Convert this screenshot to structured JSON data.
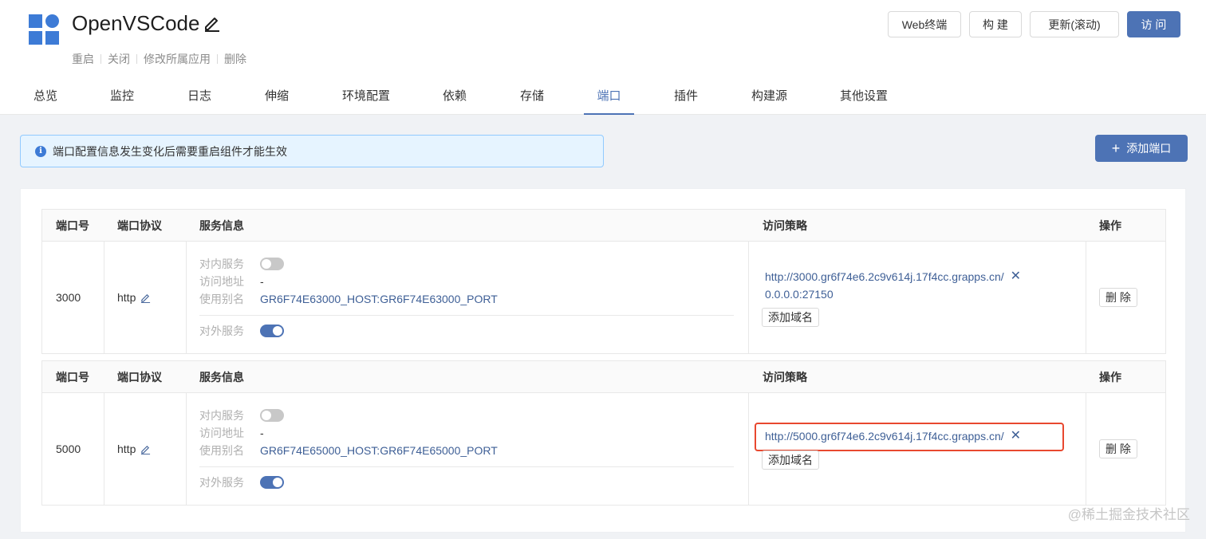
{
  "app": {
    "title": "OpenVSCode",
    "actions": [
      "重启",
      "关闭",
      "修改所属应用",
      "删除"
    ]
  },
  "top_buttons": [
    "Web终端",
    "构 建",
    "更新(滚动)",
    "访 问"
  ],
  "tabs": [
    "总览",
    "监控",
    "日志",
    "伸缩",
    "环境配置",
    "依赖",
    "存储",
    "端口",
    "插件",
    "构建源",
    "其他设置"
  ],
  "active_tab": "端口",
  "notice": {
    "icon": "info-icon",
    "text": "端口配置信息发生变化后需要重启组件才能生效"
  },
  "add_port_label": "添加端口",
  "table_headers": {
    "port": "端口号",
    "protocol": "端口协议",
    "service": "服务信息",
    "access": "访问策略",
    "ops": "操作"
  },
  "service_labels": {
    "internal": "对内服务",
    "address": "访问地址",
    "alias": "使用别名",
    "external": "对外服务"
  },
  "ports": [
    {
      "port": "3000",
      "protocol": "http",
      "internal_enabled": false,
      "address": "-",
      "alias": "GR6F74E63000_HOST:GR6F74E63000_PORT",
      "external_enabled": true,
      "url": "http://3000.gr6f74e6.2c9v614j.17f4cc.grapps.cn/",
      "ip": "0.0.0.0:27150",
      "add_domain": "添加域名",
      "delete": "删 除"
    },
    {
      "port": "5000",
      "protocol": "http",
      "internal_enabled": false,
      "address": "-",
      "alias": "GR6F74E65000_HOST:GR6F74E65000_PORT",
      "external_enabled": true,
      "url": "http://5000.gr6f74e6.2c9v614j.17f4cc.grapps.cn/",
      "add_domain": "添加域名",
      "delete": "删 除"
    }
  ],
  "watermark": "@稀土掘金技术社区",
  "colors": {
    "accent": "#4d73b5",
    "link": "#3e5f96",
    "highlight": "#e8482f"
  }
}
